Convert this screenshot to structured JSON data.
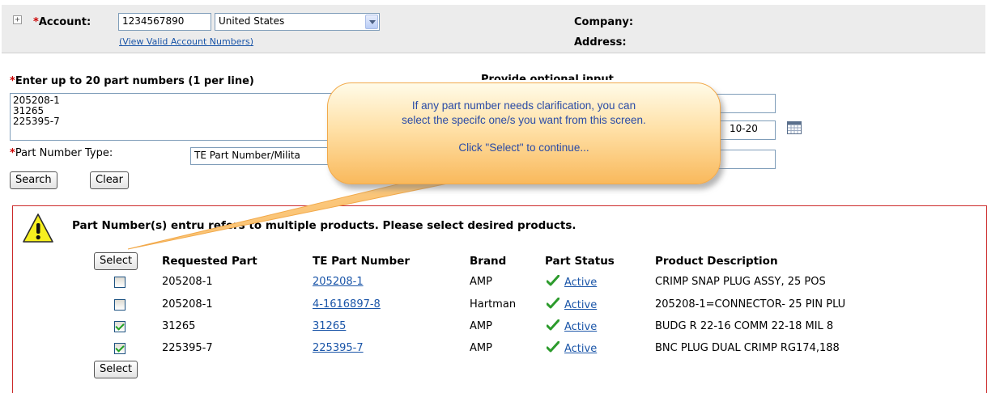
{
  "account": {
    "label": "Account:",
    "value": "1234567890",
    "country": "United States",
    "valid_link": "(View Valid Account Numbers)",
    "company_label": "Company:",
    "address_label": "Address:"
  },
  "parts_entry": {
    "heading": "Enter up to 20 part numbers (1 per line)",
    "textarea_value": "205208-1\n31265\n225395-7",
    "type_label": "Part Number Type:",
    "type_value": "TE Part Number/Milita",
    "search_label": "Search",
    "clear_label": "Clear"
  },
  "optional": {
    "heading_partial": "Provide optional input",
    "date_value": "10-20"
  },
  "callout": {
    "line1": "If any part number needs clarification, you can",
    "line2": "select the specifc one/s you want from this screen.",
    "line3": "Click \"Select\" to continue..."
  },
  "results": {
    "message_left": "Part Number(s) ent",
    "message_right": "ru refers to multiple products. Please select desired products.",
    "select_label": "Select",
    "headers": [
      "Requested Part",
      "TE Part Number",
      "Brand",
      "Part Status",
      "Product Description"
    ],
    "rows": [
      {
        "checked": false,
        "requested": "205208-1",
        "te_part": "205208-1",
        "brand": "AMP",
        "status": "Active",
        "description": "CRIMP SNAP PLUG ASSY, 25 POS"
      },
      {
        "checked": false,
        "requested": "205208-1",
        "te_part": "4-1616897-8",
        "brand": "Hartman",
        "status": "Active",
        "description": "205208-1=CONNECTOR- 25 PIN PLU"
      },
      {
        "checked": true,
        "requested": "31265",
        "te_part": "31265",
        "brand": "AMP",
        "status": "Active",
        "description": "BUDG R 22-16 COMM 22-18 MIL 8"
      },
      {
        "checked": true,
        "requested": "225395-7",
        "te_part": "225395-7",
        "brand": "AMP",
        "status": "Active",
        "description": "BNC PLUG DUAL CRIMP RG174,188"
      }
    ]
  },
  "colors": {
    "accent_red": "#cc2a2a",
    "link_blue": "#1a55a8",
    "callout_orange": "#f9b95c",
    "callout_text": "#2a4ba6"
  },
  "icons": [
    "plus-icon",
    "dropdown-arrow-icon",
    "calendar-icon",
    "warning-icon",
    "checkmark-icon"
  ]
}
